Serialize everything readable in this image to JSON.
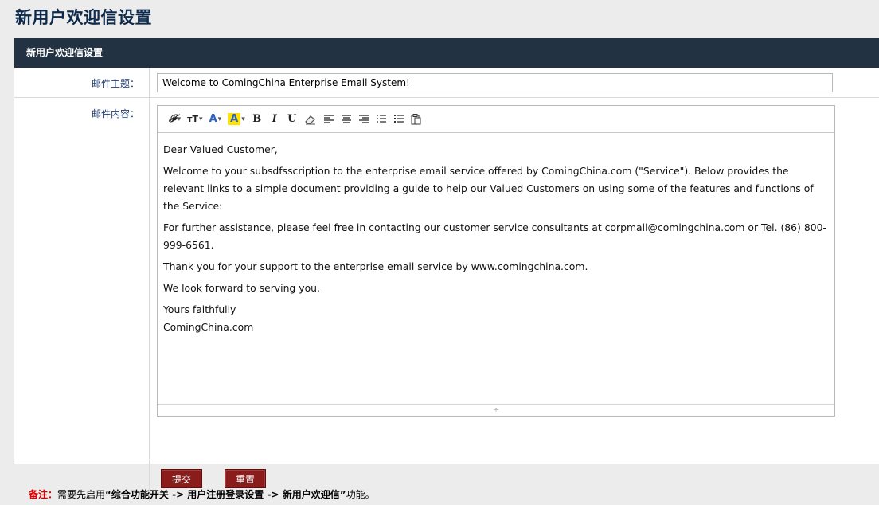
{
  "page_title": "新用户欢迎信设置",
  "panel": {
    "header": "新用户欢迎信设置",
    "subject_label": "邮件主题：",
    "subject_value": "Welcome to ComingChina Enterprise Email System!",
    "content_label": "邮件内容："
  },
  "toolbar": {
    "font": "𝓕",
    "size": "тT",
    "color": "A",
    "bgcolor": "A",
    "bold": "B",
    "italic": "I",
    "underline": "U"
  },
  "editor": {
    "paragraphs": [
      "Dear Valued Customer,",
      "Welcome to your subsdfsscription to the enterprise email service offered by ComingChina.com (\"Service\"). Below provides the relevant links to a simple document providing a guide to help our Valued Customers on using some of the features and functions of the Service:",
      "For further assistance, please feel free in contacting our customer service consultants at corpmail@comingchina.com or Tel. (86) 800-999-6561.",
      "Thank you for your support to the enterprise email service by www.comingchina.com.",
      "We look forward to serving you."
    ],
    "closing_line1": "Yours faithfully",
    "closing_line2": "ComingChina.com",
    "resize_handle": "÷"
  },
  "buttons": {
    "submit": "提交",
    "reset": "重置"
  },
  "note": {
    "label": "备注：",
    "prefix": "需要先启用",
    "path": "“综合功能开关 -> 用户注册登录设置 -> 新用户欢迎信”",
    "suffix": "功能。"
  },
  "colors": {
    "header_bg": "#223243",
    "button_bg": "#8b1c1c",
    "note_label": "#e00000",
    "label_text": "#1f3b70"
  },
  "icons": [
    "font-family-icon",
    "font-size-icon",
    "text-color-icon",
    "bg-color-icon",
    "bold-icon",
    "italic-icon",
    "underline-icon",
    "eraser-icon",
    "align-left-icon",
    "align-center-icon",
    "align-right-icon",
    "ordered-list-icon",
    "unordered-list-icon",
    "paste-icon"
  ]
}
